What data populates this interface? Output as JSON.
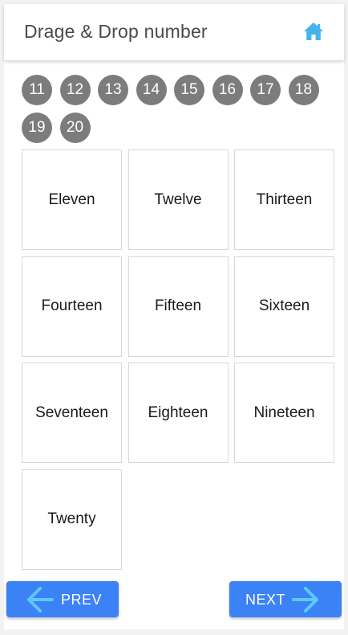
{
  "header": {
    "title": "Drage & Drop number",
    "home_icon": "home-icon"
  },
  "numbers": [
    "11",
    "12",
    "13",
    "14",
    "15",
    "16",
    "17",
    "18",
    "19",
    "20"
  ],
  "words": [
    "Eleven",
    "Twelve",
    "Thirteen",
    "Fourteen",
    "Fifteen",
    "Sixteen",
    "Seventeen",
    "Eighteen",
    "Nineteen",
    "Twenty"
  ],
  "nav": {
    "prev_label": "PREV",
    "next_label": "NEXT",
    "prev_icon": "arrow-left-icon",
    "next_icon": "arrow-right-icon"
  },
  "colors": {
    "accent": "#3b82f6",
    "arrow": "#5ec8f7",
    "chip": "#7c7c7c",
    "home": "#46b3ef"
  }
}
